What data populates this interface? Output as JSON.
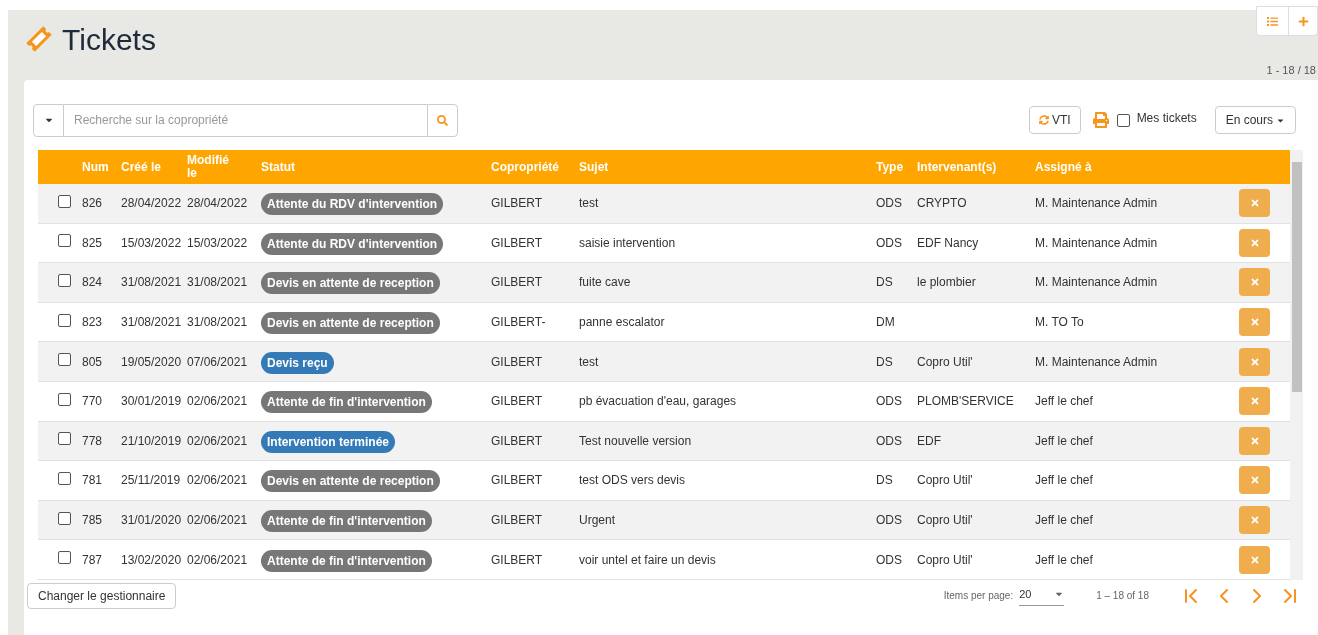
{
  "header": {
    "title": "Tickets",
    "count": "1 - 18 / 18"
  },
  "search": {
    "placeholder": "Recherche sur la copropriété"
  },
  "toolbar": {
    "vti_button": "VTI",
    "mine_checkbox": {
      "label": "Mes tickets",
      "checked": false
    },
    "filter_button": "En cours"
  },
  "table": {
    "columns": [
      "Num",
      "Créé le",
      "Modifié le",
      "Statut",
      "Copropriété",
      "Sujet",
      "Type",
      "Intervenant(s)",
      "Assigné à"
    ],
    "rows": [
      {
        "checked": false,
        "num": "826",
        "created": "28/04/2022",
        "modified": "28/04/2022",
        "status": {
          "label": "Attente du RDV d'intervention",
          "color": "#777777"
        },
        "copro": "GILBERT",
        "subject": "test",
        "type": "ODS",
        "contractor": "CRYPTO",
        "assignee": "M. Maintenance Admin"
      },
      {
        "checked": false,
        "num": "825",
        "created": "15/03/2022",
        "modified": "15/03/2022",
        "status": {
          "label": "Attente du RDV d'intervention",
          "color": "#777777"
        },
        "copro": "GILBERT",
        "subject": "saisie intervention",
        "type": "ODS",
        "contractor": "EDF Nancy",
        "assignee": "M. Maintenance Admin"
      },
      {
        "checked": false,
        "num": "824",
        "created": "31/08/2021",
        "modified": "31/08/2021",
        "status": {
          "label": "Devis en attente de reception",
          "color": "#777777"
        },
        "copro": "GILBERT",
        "subject": "fuite cave",
        "type": "DS",
        "contractor": "le plombier",
        "assignee": "M. Maintenance Admin"
      },
      {
        "checked": false,
        "num": "823",
        "created": "31/08/2021",
        "modified": "31/08/2021",
        "status": {
          "label": "Devis en attente de reception",
          "color": "#777777"
        },
        "copro": "GILBERT-",
        "subject": "panne escalator",
        "type": "DM",
        "assignee": "M. TO To"
      },
      {
        "checked": false,
        "num": "805",
        "created": "19/05/2020",
        "modified": "07/06/2021",
        "status": {
          "label": "Devis reçu",
          "color": "#337ab7"
        },
        "copro": "GILBERT",
        "subject": "test",
        "type": "DS",
        "contractor": "Copro Util'",
        "assignee": "M. Maintenance Admin"
      },
      {
        "checked": false,
        "num": "770",
        "created": "30/01/2019",
        "modified": "02/06/2021",
        "status": {
          "label": "Attente de fin d'intervention",
          "color": "#777777"
        },
        "copro": "GILBERT",
        "subject": "pb évacuation d'eau, garages",
        "type": "ODS",
        "contractor": "PLOMB'SERVICE",
        "assignee": "Jeff le chef"
      },
      {
        "checked": false,
        "num": "778",
        "created": "21/10/2019",
        "modified": "02/06/2021",
        "status": {
          "label": "Intervention terminée",
          "color": "#337ab7"
        },
        "copro": "GILBERT",
        "subject": "Test nouvelle version",
        "type": "ODS",
        "contractor": "EDF",
        "assignee": "Jeff le chef"
      },
      {
        "checked": false,
        "num": "781",
        "created": "25/11/2019",
        "modified": "02/06/2021",
        "status": {
          "label": "Devis en attente de reception",
          "color": "#777777"
        },
        "copro": "GILBERT",
        "subject": "test ODS vers devis",
        "type": "DS",
        "contractor": "Copro Util'",
        "assignee": "Jeff le chef"
      },
      {
        "checked": false,
        "num": "785",
        "created": "31/01/2020",
        "modified": "02/06/2021",
        "status": {
          "label": "Attente de fin d'intervention",
          "color": "#777777"
        },
        "copro": "GILBERT",
        "subject": "Urgent",
        "type": "ODS",
        "contractor": "Copro Util'",
        "assignee": "Jeff le chef"
      },
      {
        "checked": false,
        "num": "787",
        "created": "13/02/2020",
        "modified": "02/06/2021",
        "status": {
          "label": "Attente de fin d'intervention",
          "color": "#777777"
        },
        "copro": "GILBERT",
        "subject": "voir untel et faire un devis",
        "type": "ODS",
        "contractor": "Copro Util'",
        "assignee": "Jeff le chef"
      }
    ]
  },
  "footer": {
    "manager_button": "Changer le gestionnaire",
    "items_per_page_label": "Items per page:",
    "items_per_page": "20",
    "range": "1 – 18 of 18"
  }
}
